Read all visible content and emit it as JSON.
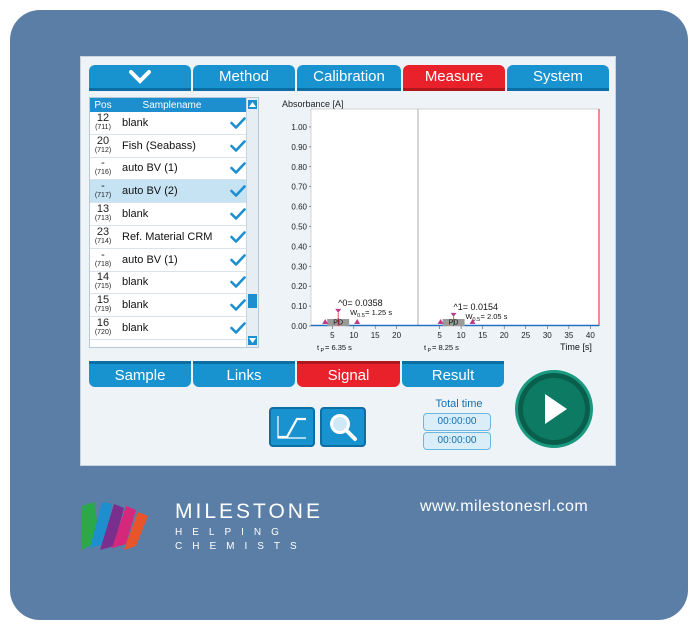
{
  "tabs_top": [
    {
      "label": "",
      "icon": "chevron-down-icon"
    },
    {
      "label": "Method"
    },
    {
      "label": "Calibration"
    },
    {
      "label": "Measure",
      "active": true
    },
    {
      "label": "System"
    }
  ],
  "samples": {
    "header_pos": "Pos",
    "header_name": "Samplename",
    "rows": [
      {
        "pos": "12",
        "sub": "(711)",
        "name": "blank"
      },
      {
        "pos": "20",
        "sub": "(712)",
        "name": "Fish (Seabass)"
      },
      {
        "pos": "-",
        "sub": "(716)",
        "name": "auto BV (1)"
      },
      {
        "pos": "-",
        "sub": "(717)",
        "name": "auto BV (2)",
        "selected": true
      },
      {
        "pos": "13",
        "sub": "(713)",
        "name": "blank"
      },
      {
        "pos": "23",
        "sub": "(714)",
        "name": "Ref. Material CRM"
      },
      {
        "pos": "-",
        "sub": "(718)",
        "name": "auto BV (1)"
      },
      {
        "pos": "14",
        "sub": "(715)",
        "name": "blank"
      },
      {
        "pos": "15",
        "sub": "(719)",
        "name": "blank"
      },
      {
        "pos": "16",
        "sub": "(720)",
        "name": "blank"
      }
    ]
  },
  "chart_data": {
    "type": "line",
    "ylabel": "Absorbance [A]",
    "xlabel": "Time [s]",
    "yticks": [
      "1.00",
      "0.90",
      "0.80",
      "0.70",
      "0.60",
      "0.50",
      "0.40",
      "0.30",
      "0.20",
      "0.10",
      "0.00"
    ],
    "ylim": [
      0,
      1.05
    ],
    "panel1": {
      "xticks": [
        "5",
        "10",
        "15",
        "20"
      ],
      "xlim": [
        0,
        25
      ],
      "peak_label": "^0= 0.0358",
      "width_label": "W",
      "width_sub": "0.5",
      "width_value": "= 1.25 s",
      "tp_label": "t",
      "tp_sub": "P",
      "tp_value": "= 6.35 s",
      "pd": "PD",
      "peak_x": 6.35,
      "peak_y": 0.0358
    },
    "panel2": {
      "xticks": [
        "5",
        "10",
        "15",
        "20",
        "25",
        "30",
        "35",
        "40"
      ],
      "xlim": [
        0,
        42
      ],
      "peak_label": "^1= 0.0154",
      "width_label": "W",
      "width_sub": "0.5",
      "width_value": "= 2.05 s",
      "tp_label": "t",
      "tp_sub": "P",
      "tp_value": "= 8.25 s",
      "pd": "PD",
      "peak_x": 8.25,
      "peak_y": 0.0154
    }
  },
  "tabs_mid": [
    {
      "label": "Sample"
    },
    {
      "label": "Links"
    },
    {
      "label": "Signal",
      "active": true
    },
    {
      "label": "Result"
    }
  ],
  "total_time": {
    "label": "Total time",
    "value1": "00:00:00",
    "value2": "00:00:00"
  },
  "brand": {
    "name": "MILESTONE",
    "tagline1": "HELPING",
    "tagline2": "CHEMISTS",
    "url": "www.milestonesrl.com"
  },
  "colors": {
    "accent": "#1992d0",
    "active": "#e8212a",
    "frame": "#5a7ea6",
    "play": "#0d7b63"
  }
}
